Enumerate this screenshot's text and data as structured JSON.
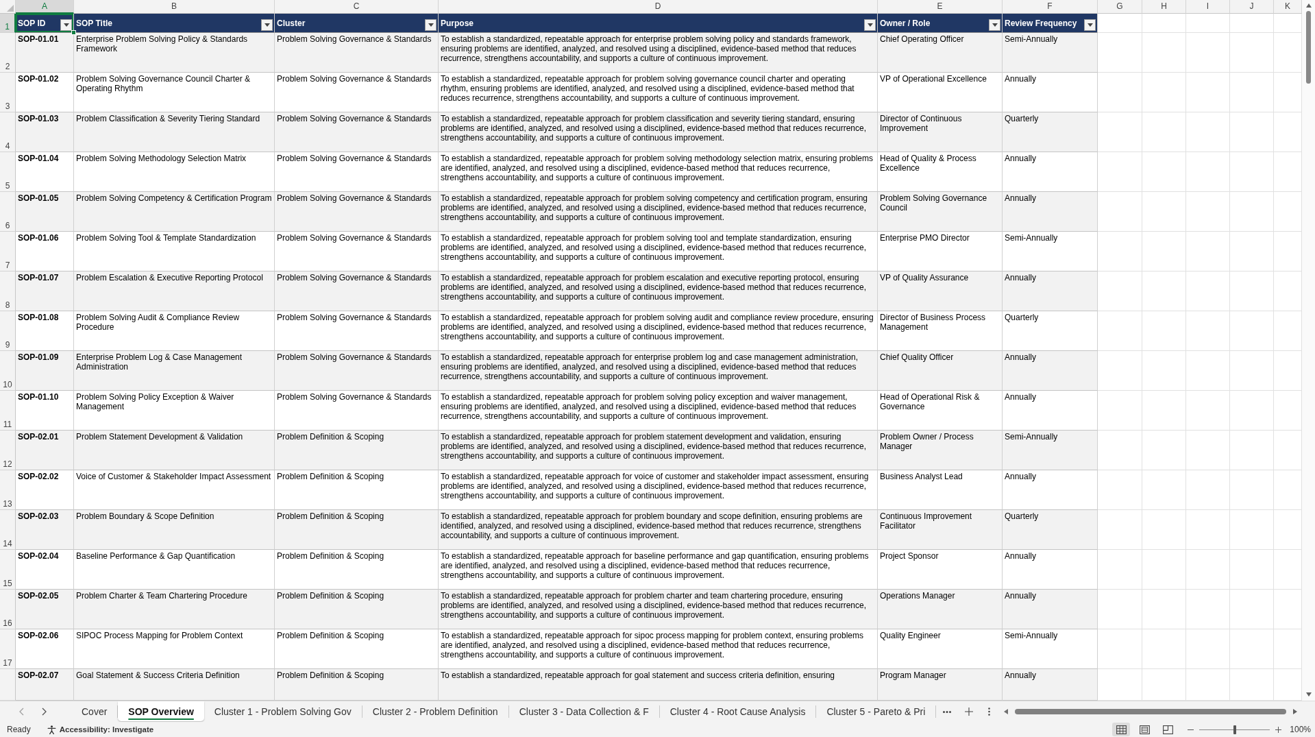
{
  "column_headers": [
    {
      "label": "A",
      "selected": true
    },
    {
      "label": "B",
      "selected": false
    },
    {
      "label": "C",
      "selected": false
    },
    {
      "label": "D",
      "selected": false
    },
    {
      "label": "E",
      "selected": false
    },
    {
      "label": "F",
      "selected": false
    },
    {
      "label": "G",
      "selected": false
    },
    {
      "label": "H",
      "selected": false
    },
    {
      "label": "I",
      "selected": false
    },
    {
      "label": "J",
      "selected": false
    },
    {
      "label": "K",
      "selected": false
    }
  ],
  "row_headers": [
    {
      "label": "1",
      "selected": true
    },
    {
      "label": "2",
      "selected": false
    },
    {
      "label": "3",
      "selected": false
    },
    {
      "label": "4",
      "selected": false
    },
    {
      "label": "5",
      "selected": false
    },
    {
      "label": "6",
      "selected": false
    },
    {
      "label": "7",
      "selected": false
    },
    {
      "label": "8",
      "selected": false
    },
    {
      "label": "9",
      "selected": false
    },
    {
      "label": "10",
      "selected": false
    },
    {
      "label": "11",
      "selected": false
    },
    {
      "label": "12",
      "selected": false
    },
    {
      "label": "13",
      "selected": false
    },
    {
      "label": "14",
      "selected": false
    },
    {
      "label": "15",
      "selected": false
    },
    {
      "label": "16",
      "selected": false
    },
    {
      "label": "17",
      "selected": false
    }
  ],
  "table": {
    "columns": [
      {
        "label": "SOP ID",
        "filter": true,
        "selected": true
      },
      {
        "label": "SOP Title",
        "filter": true,
        "selected": false
      },
      {
        "label": "Cluster",
        "filter": true,
        "selected": false
      },
      {
        "label": "Purpose",
        "filter": true,
        "selected": false
      },
      {
        "label": "Owner / Role",
        "filter": true,
        "selected": false
      },
      {
        "label": "Review Frequency",
        "filter": true,
        "selected": false
      }
    ],
    "rows": [
      [
        "SOP-01.01",
        "Enterprise Problem Solving Policy & Standards Framework",
        "Problem Solving Governance & Standards",
        "To establish a standardized, repeatable approach for enterprise problem solving policy and standards framework, ensuring problems are identified, analyzed, and resolved using a disciplined, evidence-based method that reduces recurrence, strengthens accountability, and supports a culture of continuous improvement.",
        "Chief Operating Officer",
        "Semi-Annually"
      ],
      [
        "SOP-01.02",
        "Problem Solving Governance Council Charter & Operating Rhythm",
        "Problem Solving Governance & Standards",
        "To establish a standardized, repeatable approach for problem solving governance council charter and operating rhythm, ensuring problems are identified, analyzed, and resolved using a disciplined, evidence-based method that reduces recurrence, strengthens accountability, and supports a culture of continuous improvement.",
        "VP of Operational Excellence",
        "Annually"
      ],
      [
        "SOP-01.03",
        "Problem Classification & Severity Tiering Standard",
        "Problem Solving Governance & Standards",
        "To establish a standardized, repeatable approach for problem classification and severity tiering standard, ensuring problems are identified, analyzed, and resolved using a disciplined, evidence-based method that reduces recurrence, strengthens accountability, and supports a culture of continuous improvement.",
        "Director of Continuous Improvement",
        "Quarterly"
      ],
      [
        "SOP-01.04",
        "Problem Solving Methodology Selection Matrix",
        "Problem Solving Governance & Standards",
        "To establish a standardized, repeatable approach for problem solving methodology selection matrix, ensuring problems are identified, analyzed, and resolved using a disciplined, evidence-based method that reduces recurrence, strengthens accountability, and supports a culture of continuous improvement.",
        "Head of Quality & Process Excellence",
        "Annually"
      ],
      [
        "SOP-01.05",
        "Problem Solving Competency & Certification Program",
        "Problem Solving Governance & Standards",
        "To establish a standardized, repeatable approach for problem solving competency and certification program, ensuring problems are identified, analyzed, and resolved using a disciplined, evidence-based method that reduces recurrence, strengthens accountability, and supports a culture of continuous improvement.",
        "Problem Solving Governance Council",
        "Annually"
      ],
      [
        "SOP-01.06",
        "Problem Solving Tool & Template Standardization",
        "Problem Solving Governance & Standards",
        "To establish a standardized, repeatable approach for problem solving tool and template standardization, ensuring problems are identified, analyzed, and resolved using a disciplined, evidence-based method that reduces recurrence, strengthens accountability, and supports a culture of continuous improvement.",
        "Enterprise PMO Director",
        "Semi-Annually"
      ],
      [
        "SOP-01.07",
        "Problem Escalation & Executive Reporting Protocol",
        "Problem Solving Governance & Standards",
        "To establish a standardized, repeatable approach for problem escalation and executive reporting protocol, ensuring problems are identified, analyzed, and resolved using a disciplined, evidence-based method that reduces recurrence, strengthens accountability, and supports a culture of continuous improvement.",
        "VP of Quality Assurance",
        "Annually"
      ],
      [
        "SOP-01.08",
        "Problem Solving Audit & Compliance Review Procedure",
        "Problem Solving Governance & Standards",
        "To establish a standardized, repeatable approach for problem solving audit and compliance review procedure, ensuring problems are identified, analyzed, and resolved using a disciplined, evidence-based method that reduces recurrence, strengthens accountability, and supports a culture of continuous improvement.",
        "Director of Business Process Management",
        "Quarterly"
      ],
      [
        "SOP-01.09",
        "Enterprise Problem Log & Case Management Administration",
        "Problem Solving Governance & Standards",
        "To establish a standardized, repeatable approach for enterprise problem log and case management administration, ensuring problems are identified, analyzed, and resolved using a disciplined, evidence-based method that reduces recurrence, strengthens accountability, and supports a culture of continuous improvement.",
        "Chief Quality Officer",
        "Annually"
      ],
      [
        "SOP-01.10",
        "Problem Solving Policy Exception & Waiver Management",
        "Problem Solving Governance & Standards",
        "To establish a standardized, repeatable approach for problem solving policy exception and waiver management, ensuring problems are identified, analyzed, and resolved using a disciplined, evidence-based method that reduces recurrence, strengthens accountability, and supports a culture of continuous improvement.",
        "Head of Operational Risk & Governance",
        "Annually"
      ],
      [
        "SOP-02.01",
        "Problem Statement Development & Validation",
        "Problem Definition & Scoping",
        "To establish a standardized, repeatable approach for problem statement development and validation, ensuring problems are identified, analyzed, and resolved using a disciplined, evidence-based method that reduces recurrence, strengthens accountability, and supports a culture of continuous improvement.",
        "Problem Owner / Process Manager",
        "Semi-Annually"
      ],
      [
        "SOP-02.02",
        "Voice of Customer & Stakeholder Impact Assessment",
        "Problem Definition & Scoping",
        "To establish a standardized, repeatable approach for voice of customer and stakeholder impact assessment, ensuring problems are identified, analyzed, and resolved using a disciplined, evidence-based method that reduces recurrence, strengthens accountability, and supports a culture of continuous improvement.",
        "Business Analyst Lead",
        "Annually"
      ],
      [
        "SOP-02.03",
        "Problem Boundary & Scope Definition",
        "Problem Definition & Scoping",
        "To establish a standardized, repeatable approach for problem boundary and scope definition, ensuring problems are identified, analyzed, and resolved using a disciplined, evidence-based method that reduces recurrence, strengthens accountability, and supports a culture of continuous improvement.",
        "Continuous Improvement Facilitator",
        "Quarterly"
      ],
      [
        "SOP-02.04",
        "Baseline Performance & Gap Quantification",
        "Problem Definition & Scoping",
        "To establish a standardized, repeatable approach for baseline performance and gap quantification, ensuring problems are identified, analyzed, and resolved using a disciplined, evidence-based method that reduces recurrence, strengthens accountability, and supports a culture of continuous improvement.",
        "Project Sponsor",
        "Annually"
      ],
      [
        "SOP-02.05",
        "Problem Charter & Team Chartering Procedure",
        "Problem Definition & Scoping",
        "To establish a standardized, repeatable approach for problem charter and team chartering procedure, ensuring problems are identified, analyzed, and resolved using a disciplined, evidence-based method that reduces recurrence, strengthens accountability, and supports a culture of continuous improvement.",
        "Operations Manager",
        "Annually"
      ],
      [
        "SOP-02.06",
        "SIPOC Process Mapping for Problem Context",
        "Problem Definition & Scoping",
        "To establish a standardized, repeatable approach for sipoc process mapping for problem context, ensuring problems are identified, analyzed, and resolved using a disciplined, evidence-based method that reduces recurrence, strengthens accountability, and supports a culture of continuous improvement.",
        "Quality Engineer",
        "Semi-Annually"
      ],
      [
        "SOP-02.07",
        "Goal Statement & Success Criteria Definition",
        "Problem Definition & Scoping",
        "To establish a standardized, repeatable approach for goal statement and success criteria definition, ensuring",
        "Program Manager",
        "Annually"
      ]
    ]
  },
  "sheet_tabs": [
    {
      "label": "Cover",
      "selected": false
    },
    {
      "label": "SOP Overview",
      "selected": true
    },
    {
      "label": "Cluster 1 - Problem Solving Gov",
      "selected": false
    },
    {
      "label": "Cluster 2 - Problem Definition",
      "selected": false
    },
    {
      "label": "Cluster 3 - Data Collection & F",
      "selected": false
    },
    {
      "label": "Cluster 4 - Root Cause Analysis",
      "selected": false
    },
    {
      "label": "Cluster 5 - Pareto & Pri",
      "selected": false
    }
  ],
  "status_bar": {
    "mode": "Ready",
    "accessibility": "Accessibility: Investigate",
    "views": [
      {
        "kind": "normal",
        "selected": true
      },
      {
        "kind": "page_layout",
        "selected": false
      },
      {
        "kind": "page_break",
        "selected": false
      }
    ],
    "zoom": {
      "level": 0.5,
      "label": "100%"
    }
  }
}
